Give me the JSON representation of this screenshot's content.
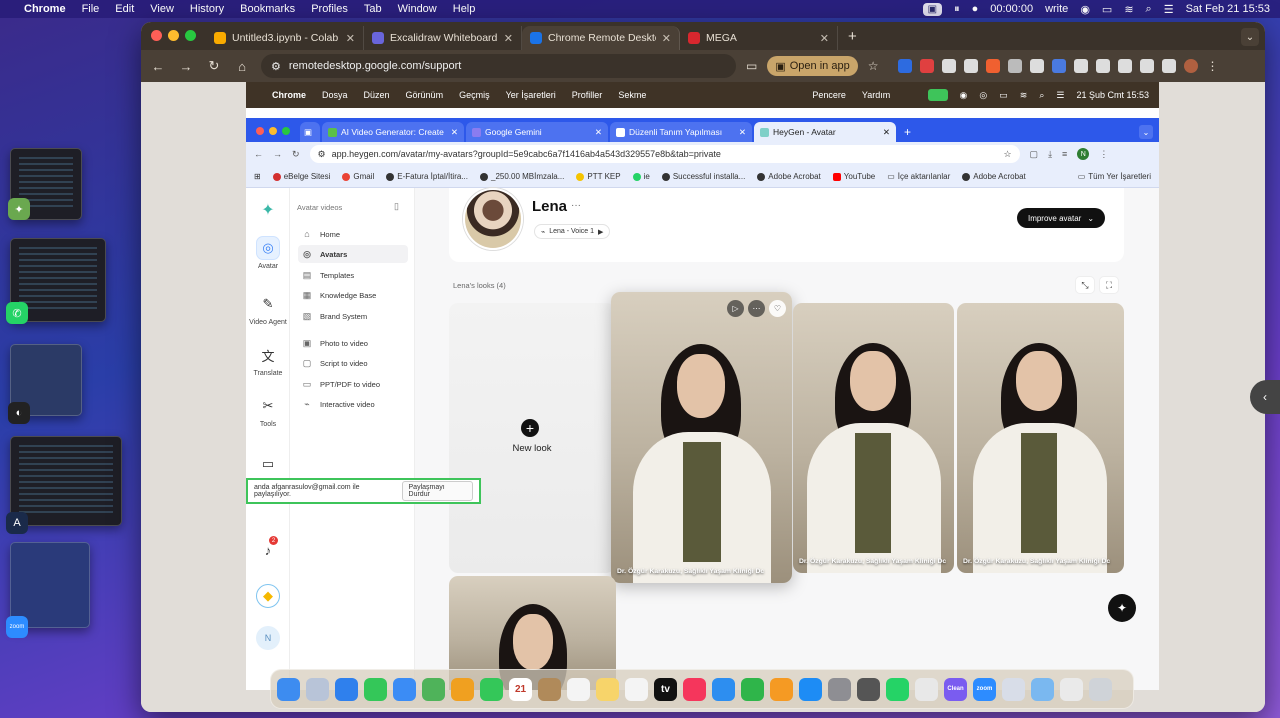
{
  "menubar": {
    "app": "Chrome",
    "menus": [
      "File",
      "Edit",
      "View",
      "History",
      "Bookmarks",
      "Profiles",
      "Tab",
      "Window",
      "Help"
    ],
    "timer": "00:00:00",
    "write": "write",
    "datetime": "Sat Feb 21  15:53"
  },
  "outer_tabs": [
    {
      "title": "Untitled3.ipynb - Colab",
      "color": "#f9ab00"
    },
    {
      "title": "Excalidraw Whiteboard",
      "color": "#6965db"
    },
    {
      "title": "Chrome Remote Desktop",
      "color": "#1a73e8"
    },
    {
      "title": "MEGA",
      "color": "#d9272e"
    }
  ],
  "outer_toolbar": {
    "url": "remotedesktop.google.com/support",
    "open_in_app": "Open in app"
  },
  "inner_menubar": {
    "app": "Chrome",
    "menus": [
      "Dosya",
      "Düzen",
      "Görünüm",
      "Geçmiş",
      "Yer İşaretleri",
      "Profiller",
      "Sekme",
      "Pencere",
      "Yardım"
    ],
    "datetime": "21 Şub Cmt  15:53"
  },
  "inner_tabs": [
    {
      "title": "AI Video Generator: Create ...",
      "color": "#5bbf4a"
    },
    {
      "title": "Google Gemini",
      "color": "#8a7cf0"
    },
    {
      "title": "Düzenli Tanım Yapılması",
      "color": "#ffffff"
    },
    {
      "title": "HeyGen - Avatar",
      "color": "#7fd0c8"
    }
  ],
  "inner_toolbar": {
    "url": "app.heygen.com/avatar/my-avatars?groupId=5e9cabc6a7f1416ab4a543d329557e8b&tab=private",
    "profile_letter": "N"
  },
  "bookmarks": [
    {
      "label": "eBelge Sitesi",
      "color": "#d32f2f"
    },
    {
      "label": "Gmail",
      "color": "#ea4335"
    },
    {
      "label": "E-Fatura İptal/İtira...",
      "color": "#333333"
    },
    {
      "label": "_250.00 MBİmzala...",
      "color": "#333333"
    },
    {
      "label": "PTT KEP",
      "color": "#f5c400"
    },
    {
      "label": "ie",
      "color": "#25d366"
    },
    {
      "label": "Successful installa...",
      "color": "#333333"
    },
    {
      "label": "Adobe Acrobat",
      "color": "#333333"
    },
    {
      "label": "YouTube",
      "color": "#ff0000"
    },
    {
      "label": "İçe aktarılanlar",
      "color": "#777777"
    },
    {
      "label": "Adobe Acrobat",
      "color": "#333333"
    }
  ],
  "bookmarks_right": "Tüm Yer İşaretleri",
  "rail": [
    {
      "label": "Avatar",
      "icon": "person-icon"
    },
    {
      "label": "Video Agent",
      "icon": "wand-icon"
    },
    {
      "label": "Translate",
      "icon": "translate-icon"
    },
    {
      "label": "Tools",
      "icon": "tools-icon"
    }
  ],
  "panel": {
    "heading": "Avatar videos",
    "items": [
      {
        "label": "Home",
        "icon": "⌂"
      },
      {
        "label": "Avatars",
        "icon": "◎"
      },
      {
        "label": "Templates",
        "icon": "▤"
      },
      {
        "label": "Knowledge Base",
        "icon": "▦"
      },
      {
        "label": "Brand System",
        "icon": "▧"
      }
    ],
    "items2": [
      {
        "label": "Photo to video",
        "icon": "▣"
      },
      {
        "label": "Script to video",
        "icon": "▢"
      },
      {
        "label": "PPT/PDF to video",
        "icon": "▭"
      },
      {
        "label": "Interactive video",
        "icon": "⌁"
      }
    ],
    "notification_count": "2",
    "user_letter": "N"
  },
  "share_bar": {
    "text": "anda afganrasulov@gmail.com ile paylaşılıyor.",
    "stop_label": "Paylaşmayı Durdur"
  },
  "profile": {
    "name": "Lena",
    "more": "···",
    "voice": "Lena - Voice 1",
    "improve_label": "Improve avatar"
  },
  "looks": {
    "label": "Lena's looks (4)",
    "new_look": "New look",
    "cards": [
      {
        "caption": "Dr. Özgür Karakuzu, Sağlıklı Yaşam Kliniği Dc"
      },
      {
        "caption": "Dr. Özgür Karakuzu, Sağlıklı Yaşam Kliniği Dc"
      },
      {
        "caption": "Dr. Özgür Karakuzu, Sağlıklı Yaşam Kliniği Dc"
      }
    ]
  },
  "dock": [
    {
      "name": "finder-icon",
      "color": "#3d8cf0",
      "label": ""
    },
    {
      "name": "launchpad-icon",
      "color": "#b8c4d8",
      "label": ""
    },
    {
      "name": "safari-icon",
      "color": "#2f80ed",
      "label": ""
    },
    {
      "name": "messages-icon",
      "color": "#34c759",
      "label": ""
    },
    {
      "name": "mail-icon",
      "color": "#3b8cf5",
      "label": ""
    },
    {
      "name": "maps-icon",
      "color": "#4fb35a",
      "label": ""
    },
    {
      "name": "photos-icon",
      "color": "#f0a020",
      "label": ""
    },
    {
      "name": "facetime-icon",
      "color": "#34c759",
      "label": ""
    },
    {
      "name": "calendar-icon",
      "color": "#ffffff",
      "label": "21"
    },
    {
      "name": "contacts-icon",
      "color": "#b08a5a",
      "label": ""
    },
    {
      "name": "reminders-icon",
      "color": "#f4f4f4",
      "label": ""
    },
    {
      "name": "notes-icon",
      "color": "#f7d46a",
      "label": ""
    },
    {
      "name": "freeform-icon",
      "color": "#f4f4f4",
      "label": ""
    },
    {
      "name": "tv-icon",
      "color": "#111111",
      "label": "tv"
    },
    {
      "name": "music-icon",
      "color": "#f5365c",
      "label": ""
    },
    {
      "name": "keynote-icon",
      "color": "#2d8ef0",
      "label": ""
    },
    {
      "name": "numbers-icon",
      "color": "#2fb54a",
      "label": ""
    },
    {
      "name": "pages-icon",
      "color": "#f59a23",
      "label": ""
    },
    {
      "name": "appstore-icon",
      "color": "#1d8cf5",
      "label": ""
    },
    {
      "name": "settings-icon",
      "color": "#8e8e93",
      "label": ""
    },
    {
      "name": "iphone-mirroring-icon",
      "color": "#555555",
      "label": ""
    },
    {
      "name": "whatsapp-icon",
      "color": "#25d366",
      "label": ""
    },
    {
      "name": "chrome-icon",
      "color": "#e8e8e8",
      "label": ""
    },
    {
      "name": "clean-icon",
      "color": "#7a5cf0",
      "label": "Clean"
    },
    {
      "name": "zoom-icon",
      "color": "#2d8cff",
      "label": "zoom"
    },
    {
      "name": "screen-icon",
      "color": "#d8dde8",
      "label": ""
    },
    {
      "name": "folder-icon",
      "color": "#7ab8f0",
      "label": ""
    },
    {
      "name": "preview-icon",
      "color": "#eaeaea",
      "label": ""
    },
    {
      "name": "trash-icon",
      "color": "#cfd3d8",
      "label": ""
    }
  ]
}
